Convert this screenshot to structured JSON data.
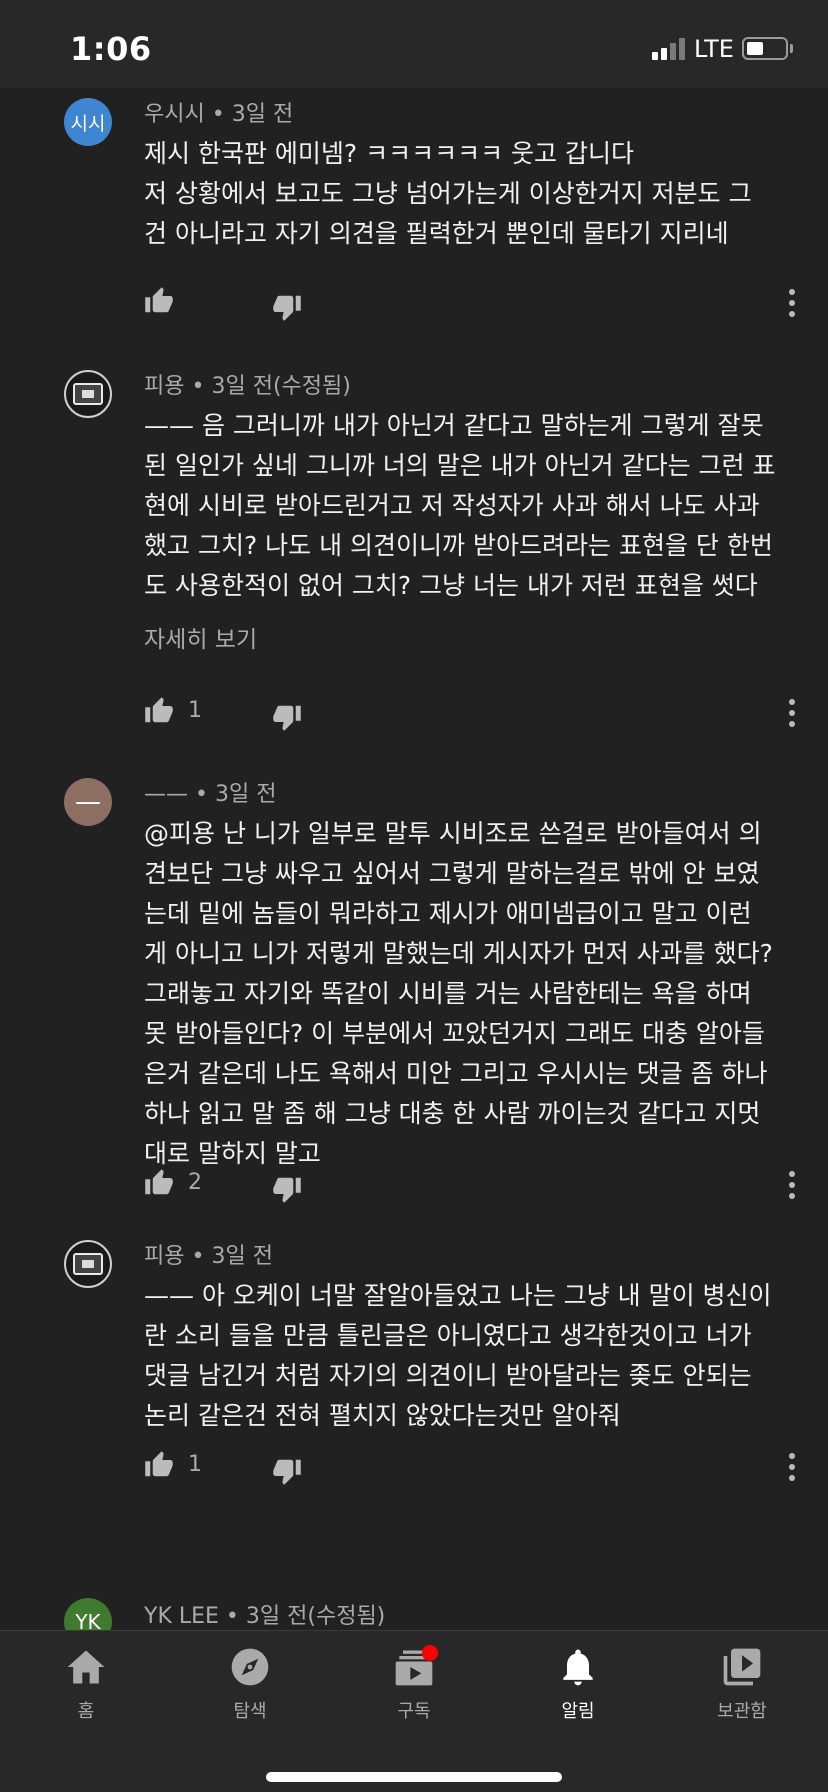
{
  "status_bar": {
    "time": "1:06",
    "network": "LTE"
  },
  "comments": [
    {
      "avatar_text": "시시",
      "author": "우시시",
      "time": "3일 전",
      "text_lines": [
        "제시 한국판 에미넴? ㅋㅋㅋㅋㅋㅋ 웃고 갑니다",
        "저 상황에서 보고도 그냥 넘어가는게 이상한거지 저분도 그",
        "건 아니라고 자기 의견을 필력한거 뿐인데 물타기 지리네"
      ],
      "likes": ""
    },
    {
      "avatar_text": "",
      "author": "피용",
      "time": "3일 전(수정됨)",
      "text_lines": [
        "—— 음 그러니까 내가 아닌거 같다고 말하는게 그렇게 잘못",
        "된 일인가 싶네 그니까 너의 말은 내가 아닌거 같다는 그런 표",
        "현에 시비로 받아드린거고 저 작성자가 사과 해서 나도 사과",
        "했고 그치? 나도 내 의견이니까 받아드려라는 표현을 단 한번",
        "도 사용한적이 없어 그치? 그냥 너는 내가 저런 표현을 썻다"
      ],
      "more_label": "자세히 보기",
      "likes": "1"
    },
    {
      "avatar_text": "—",
      "author": "——",
      "time": "3일 전",
      "text_lines": [
        "@피용 난 니가 일부로 말투 시비조로 쓴걸로 받아들여서 의",
        "견보단 그냥 싸우고 싶어서 그렇게 말하는걸로 밖에 안 보였",
        "는데 밑에 놈들이 뭐라하고 제시가 애미넴급이고 말고 이런",
        "게 아니고 니가 저렇게 말했는데 게시자가 먼저 사과를 했다?",
        "그래놓고 자기와 똑같이 시비를 거는 사람한테는 욕을 하며",
        "못 받아들인다? 이 부분에서 꼬았던거지 그래도 대충 알아들",
        "은거 같은데 나도 욕해서 미안 그리고 우시시는 댓글 좀 하나",
        "하나 읽고 말 좀 해 그냥 대충 한 사람 까이는것 같다고 지멋",
        "대로 말하지 말고"
      ],
      "likes": "2"
    },
    {
      "avatar_text": "",
      "author": "피용",
      "time": "3일 전",
      "text_lines": [
        "—— 아 오케이 너말 잘알아들었고 나는 그냥 내 말이 병신이",
        "란 소리 들을 만큼 틀린글은 아니였다고 생각한것이고 너가",
        "댓글 남긴거 처럼 자기의 의견이니 받아달라는 좆도 안되는",
        "논리 같은건 전혀 펼치지 않았다는것만 알아줘"
      ],
      "likes": "1"
    },
    {
      "avatar_text": "YK",
      "author": "YK LEE",
      "time": "3일 전(수정됨)"
    }
  ],
  "bottom_nav": [
    {
      "label": "홈",
      "icon": "home-icon"
    },
    {
      "label": "탐색",
      "icon": "explore-icon"
    },
    {
      "label": "구독",
      "icon": "subscriptions-icon"
    },
    {
      "label": "알림",
      "icon": "notifications-icon"
    },
    {
      "label": "보관함",
      "icon": "library-icon"
    }
  ],
  "colors": {
    "background": "#212121",
    "bar": "#282828",
    "secondary_text": "#aaaaaa",
    "notification_dot": "#ff0000"
  }
}
